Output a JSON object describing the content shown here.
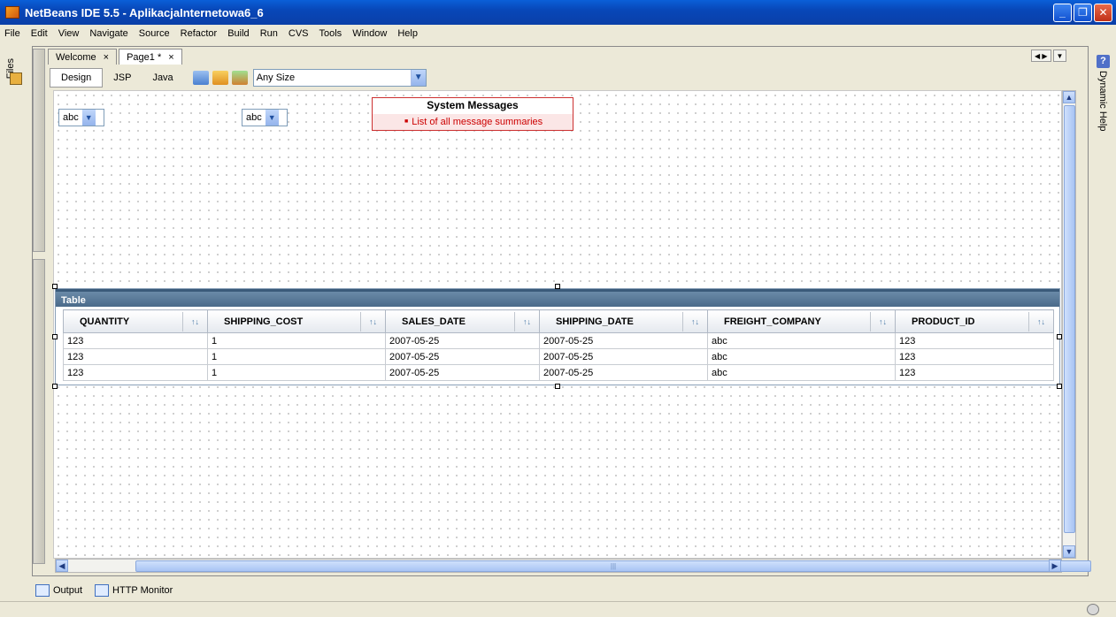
{
  "window": {
    "title": "NetBeans IDE 5.5 - AplikacjaInternetowa6_6"
  },
  "menu": [
    "File",
    "Edit",
    "View",
    "Navigate",
    "Source",
    "Refactor",
    "Build",
    "Run",
    "CVS",
    "Tools",
    "Window",
    "Help"
  ],
  "left_sidebar": {
    "files_tab": "Files"
  },
  "right_sidebar": {
    "dynamic_help_tab": "Dynamic Help"
  },
  "editor_tabs": [
    {
      "label": "Welcome",
      "close": "×"
    },
    {
      "label": "Page1 *",
      "close": "×"
    }
  ],
  "view_tabs": [
    "Design",
    "JSP",
    "Java"
  ],
  "size_combo": {
    "value": "Any Size"
  },
  "canvas": {
    "dropdown1": "abc",
    "dropdown2": "abc",
    "system_messages": {
      "title": "System Messages",
      "item": "List of all message summaries"
    },
    "table": {
      "caption": "Table",
      "columns": [
        "QUANTITY",
        "SHIPPING_COST",
        "SALES_DATE",
        "SHIPPING_DATE",
        "FREIGHT_COMPANY",
        "PRODUCT_ID"
      ],
      "rows": [
        [
          "123",
          "1",
          "2007-05-25",
          "2007-05-25",
          "abc",
          "123"
        ],
        [
          "123",
          "1",
          "2007-05-25",
          "2007-05-25",
          "abc",
          "123"
        ],
        [
          "123",
          "1",
          "2007-05-25",
          "2007-05-25",
          "abc",
          "123"
        ]
      ]
    }
  },
  "bottom_tabs": {
    "output": "Output",
    "http_monitor": "HTTP Monitor"
  },
  "colors": {
    "title_bar": "#0a5fd8",
    "table_header": "#4a6a8a",
    "messages_border": "#cc3030"
  }
}
